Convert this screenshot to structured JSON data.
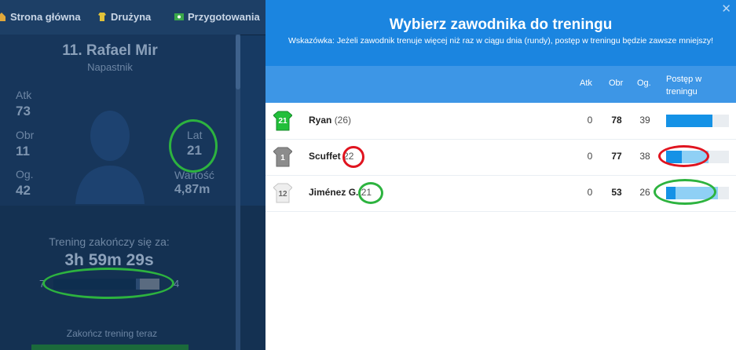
{
  "nav": {
    "items": [
      {
        "label": "Strona główna",
        "icon": "home-icon"
      },
      {
        "label": "Drużyna",
        "icon": "shirt-icon"
      },
      {
        "label": "Przygotowania",
        "icon": "training-icon"
      }
    ]
  },
  "player_card": {
    "title": "11. Rafael Mir",
    "position": "Napastnik",
    "stats": {
      "atk_label": "Atk",
      "atk_value": "73",
      "obr_label": "Obr",
      "obr_value": "11",
      "og_label": "Og.",
      "og_value": "42",
      "lat_label": "Lat",
      "lat_value": "21",
      "wartosc_label": "Wartość",
      "wartosc_value": "4,87m"
    },
    "training": {
      "label": "Trening zakończy się za:",
      "time": "3h 59m 29s",
      "bar_left": "7",
      "bar_right": "4",
      "progress_fraction": 0.78,
      "finish_now": "Zakończ trening teraz"
    }
  },
  "modal": {
    "title": "Wybierz zawodnika do treningu",
    "hint": "Wskazówka: Jeżeli zawodnik trenuje więcej niż raz w ciągu dnia (rundy), postęp w treningu będzie zawsze mniejszy!",
    "columns": {
      "atk": "Atk",
      "obr": "Obr",
      "og": "Og.",
      "progress": "Postęp w treningu"
    },
    "rows": [
      {
        "number": "21",
        "name": "Ryan",
        "age": "(26)",
        "atk": "0",
        "obr": "78",
        "og": "39",
        "progress_fraction": 0.74,
        "progress_light_fraction": 0.0,
        "shirt_color": "#22bf3a"
      },
      {
        "number": "1",
        "name": "Scuffet",
        "age": "22",
        "atk": "0",
        "obr": "77",
        "og": "38",
        "progress_fraction": 0.25,
        "progress_light_fraction": 0.43,
        "shirt_color": "#8c8c8c"
      },
      {
        "number": "12",
        "name": "Jiménez G.",
        "age": "21",
        "atk": "0",
        "obr": "53",
        "og": "26",
        "progress_fraction": 0.15,
        "progress_light_fraction": 0.68,
        "shirt_color": "#eeeeee"
      }
    ]
  },
  "colors": {
    "header_blue": "#1b85e0",
    "table_head_blue": "#3d96e6",
    "progress_blue": "#1592e6",
    "annotation_green": "#2db33f",
    "annotation_red": "#e0141f"
  }
}
